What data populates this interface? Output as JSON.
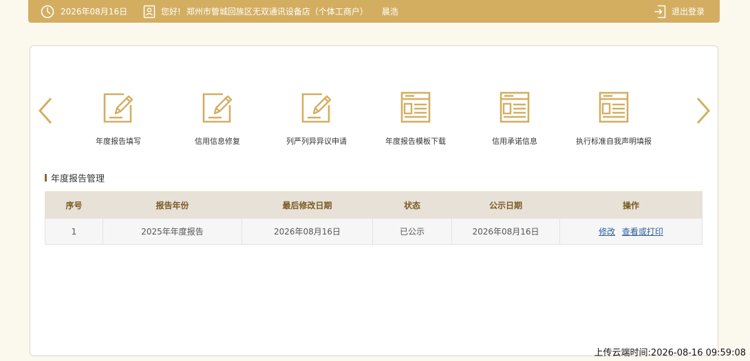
{
  "header": {
    "date": "2026年08月16日",
    "greeting": "您好!",
    "company": "郑州市管城回族区无双通讯设备店（个体工商户）",
    "username": "晨浩",
    "logout_label": "退出登录",
    "icons": {
      "date": "clock-icon",
      "user": "user-card-icon",
      "logout": "logout-icon"
    }
  },
  "menu": {
    "items": [
      {
        "label": "年度报告填写",
        "icon": "edit-icon"
      },
      {
        "label": "信用信息修复",
        "icon": "edit-icon"
      },
      {
        "label": "列严列异异议申请",
        "icon": "edit-icon"
      },
      {
        "label": "年度报告模板下载",
        "icon": "form-icon"
      },
      {
        "label": "信用承诺信息",
        "icon": "form-icon"
      },
      {
        "label": "执行标准自我声明填报",
        "icon": "form-icon"
      }
    ],
    "icons": {
      "prev": "chevron-left-icon",
      "next": "chevron-right-icon"
    }
  },
  "section": {
    "title": "年度报告管理"
  },
  "table": {
    "headers": [
      "序号",
      "报告年份",
      "最后修改日期",
      "状态",
      "公示日期",
      "操作"
    ],
    "rows": [
      {
        "index": "1",
        "report_year": "2025年年度报告",
        "modified_date": "2026年08月16日",
        "status": "已公示",
        "publish_date": "2026年08月16日",
        "actions": [
          "修改",
          "查看或打印"
        ]
      }
    ]
  },
  "footer": {
    "upload_time": "上传云端时间:2026-08-16 09:59:08"
  },
  "colors": {
    "accent": "#d3ae61",
    "header_text": "#7a5a24",
    "link": "#2c5f9e"
  }
}
